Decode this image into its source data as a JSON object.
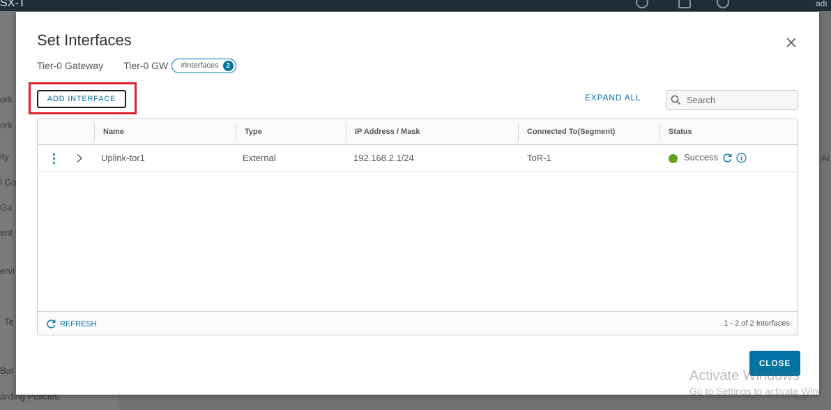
{
  "background": {
    "brand": "SX-T",
    "user": "adı",
    "sidebar_fragments": [
      "ork",
      "ork",
      "ity",
      "l Ga",
      "Ga",
      "ent",
      "ervi",
      "Te",
      "Bal",
      "arding Policies"
    ],
    "main_fragment": "Al"
  },
  "modal": {
    "title": "Set Interfaces",
    "gateway_type": "Tier-0 Gateway",
    "gateway_name": "Tier-0 GW",
    "interfaces_badge_label": "#Interfaces",
    "interfaces_count": "2",
    "add_button": "ADD INTERFACE",
    "expand_all": "EXPAND ALL",
    "search_placeholder": "Search",
    "close_button": "CLOSE"
  },
  "grid": {
    "columns": [
      "Name",
      "Type",
      "IP Address / Mask",
      "Connected To(Segment)",
      "Status"
    ],
    "rows": [
      {
        "name": "Uplink-tor1",
        "type": "External",
        "ip": "192.168.2.1/24",
        "segment": "ToR-1",
        "status": "Success",
        "status_color": "#62a420"
      }
    ],
    "refresh": "REFRESH",
    "pagination": "1 - 2 of 2 Interfaces"
  },
  "watermark": {
    "line1": "Activate Windows",
    "line2": "Go to Settings to activate Windows."
  },
  "colors": {
    "accent": "#0072a3",
    "highlight": "#e0202b",
    "success": "#62a420"
  }
}
